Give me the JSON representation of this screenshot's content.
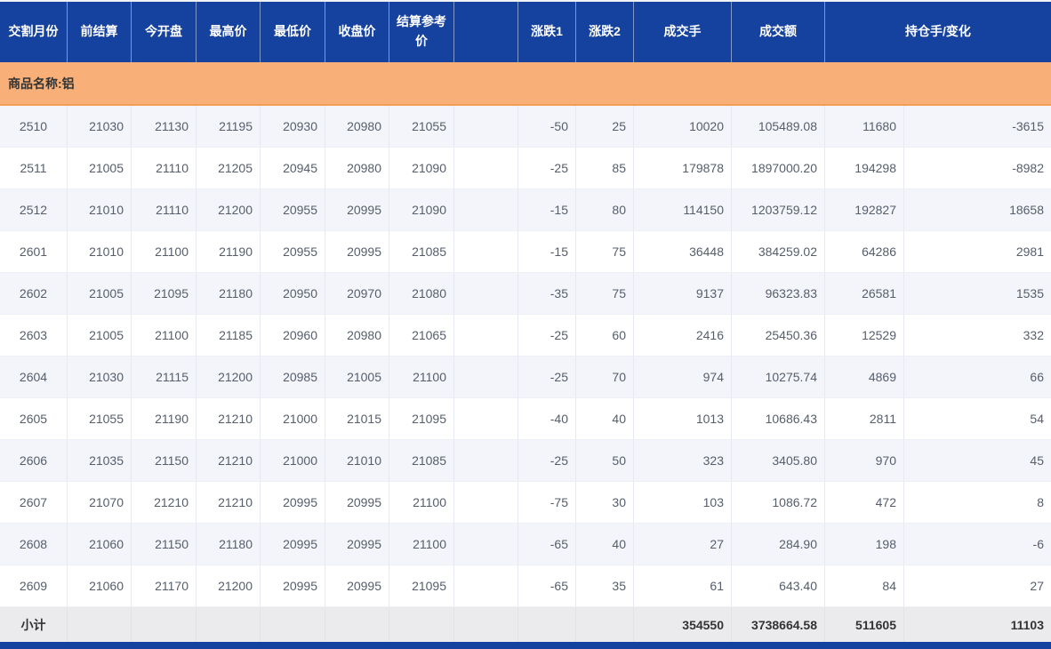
{
  "colors": {
    "header_bg": "#16429f",
    "header_text": "#ffffff",
    "commodity_bg": "#f8b078",
    "row_alt_bg": "#f3f5fa",
    "row_bg": "#ffffff",
    "subtotal_bg": "#ebebed",
    "body_text": "#565e6b"
  },
  "table": {
    "columns": [
      "交割月份",
      "前结算",
      "今开盘",
      "最高价",
      "最低价",
      "收盘价",
      "结算参考价",
      "",
      "涨跌1",
      "涨跌2",
      "成交手",
      "成交额",
      "持仓手/变化"
    ],
    "commodity_label": "商品名称:铝",
    "rows": [
      [
        "2510",
        "21030",
        "21130",
        "21195",
        "20930",
        "20980",
        "21055",
        "",
        "-50",
        "25",
        "10020",
        "105489.08",
        "11680",
        "-3615"
      ],
      [
        "2511",
        "21005",
        "21110",
        "21205",
        "20945",
        "20980",
        "21090",
        "",
        "-25",
        "85",
        "179878",
        "1897000.20",
        "194298",
        "-8982"
      ],
      [
        "2512",
        "21010",
        "21110",
        "21200",
        "20955",
        "20995",
        "21090",
        "",
        "-15",
        "80",
        "114150",
        "1203759.12",
        "192827",
        "18658"
      ],
      [
        "2601",
        "21010",
        "21100",
        "21190",
        "20955",
        "20995",
        "21085",
        "",
        "-15",
        "75",
        "36448",
        "384259.02",
        "64286",
        "2981"
      ],
      [
        "2602",
        "21005",
        "21095",
        "21180",
        "20950",
        "20970",
        "21080",
        "",
        "-35",
        "75",
        "9137",
        "96323.83",
        "26581",
        "1535"
      ],
      [
        "2603",
        "21005",
        "21100",
        "21185",
        "20960",
        "20980",
        "21065",
        "",
        "-25",
        "60",
        "2416",
        "25450.36",
        "12529",
        "332"
      ],
      [
        "2604",
        "21030",
        "21115",
        "21200",
        "20985",
        "21005",
        "21100",
        "",
        "-25",
        "70",
        "974",
        "10275.74",
        "4869",
        "66"
      ],
      [
        "2605",
        "21055",
        "21190",
        "21210",
        "21000",
        "21015",
        "21095",
        "",
        "-40",
        "40",
        "1013",
        "10686.43",
        "2811",
        "54"
      ],
      [
        "2606",
        "21035",
        "21150",
        "21210",
        "21000",
        "21010",
        "21085",
        "",
        "-25",
        "50",
        "323",
        "3405.80",
        "970",
        "45"
      ],
      [
        "2607",
        "21070",
        "21210",
        "21210",
        "20995",
        "20995",
        "21100",
        "",
        "-75",
        "30",
        "103",
        "1086.72",
        "472",
        "8"
      ],
      [
        "2608",
        "21060",
        "21150",
        "21180",
        "20995",
        "20995",
        "21100",
        "",
        "-65",
        "40",
        "27",
        "284.90",
        "198",
        "-6"
      ],
      [
        "2609",
        "21060",
        "21170",
        "21200",
        "20995",
        "20995",
        "21095",
        "",
        "-65",
        "35",
        "61",
        "643.40",
        "84",
        "27"
      ]
    ],
    "subtotal": [
      "小计",
      "",
      "",
      "",
      "",
      "",
      "",
      "",
      "",
      "",
      "354550",
      "3738664.58",
      "511605",
      "11103"
    ]
  }
}
